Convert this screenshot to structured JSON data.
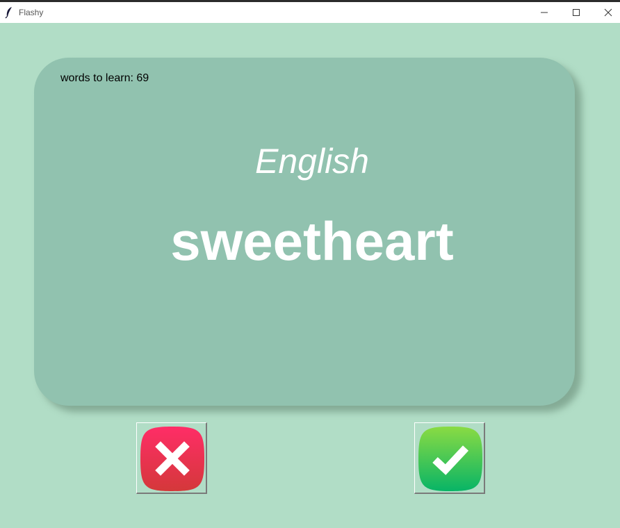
{
  "window": {
    "title": "Flashy"
  },
  "card": {
    "words_to_learn": "words to learn: 69",
    "language": "English",
    "word": "sweetheart"
  },
  "buttons": {
    "wrong_icon": "x-icon",
    "right_icon": "checkmark-icon"
  },
  "colors": {
    "background": "#B1DDC6",
    "card_back": "#91C2AF",
    "wrong": "#E8334F",
    "right": "#3CC34E"
  }
}
